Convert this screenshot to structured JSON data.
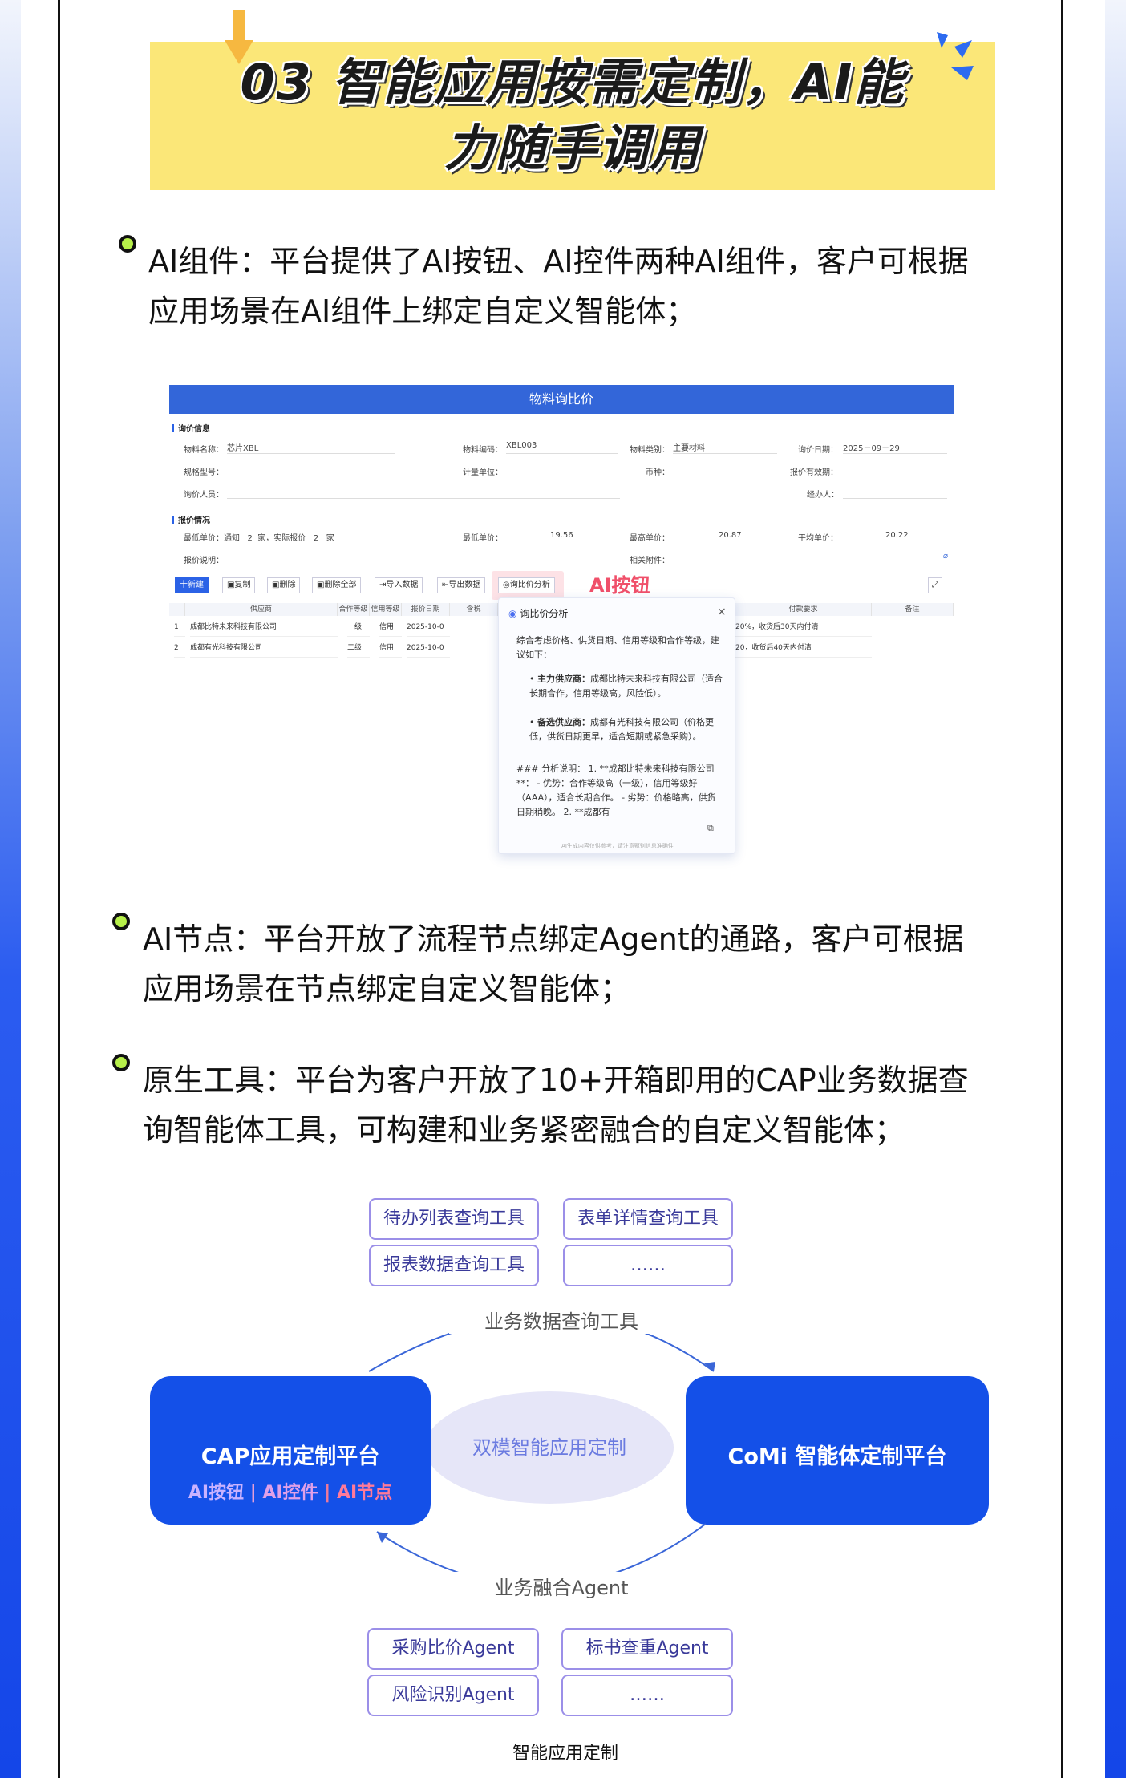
{
  "page": {
    "title_line1": "03 智能应用按需定制，AI能",
    "title_line2": "力随手调用",
    "bullets": [
      {
        "label": "AI组件：平台提供了AI按钮、AI控件两种AI组件，客户可根据",
        "label2": "应用场景在AI组件上绑定自定义智能体；"
      },
      {
        "label": "AI节点：平台开放了流程节点绑定Agent的通路，客户可根据",
        "label2": "应用场景在节点绑定自定义智能体；"
      },
      {
        "label": "原生工具：平台为客户开放了10+开箱即用的CAP业务数据查",
        "label2": "询智能体工具，可构建和业务紧密融合的自定义智能体；"
      }
    ],
    "colors": {
      "accent": "#1450e8",
      "highlight": "#fbe778",
      "bullet": "#b7f04a",
      "ai_red": "#f0506a"
    }
  },
  "shot": {
    "window_title": "物料询比价",
    "sec_inquiry": "询价信息",
    "fields": {
      "material_name_label": "物料名称：",
      "material_name": "芯片XBL",
      "material_code_label": "物料编码：",
      "material_code": "XBL003",
      "material_cat_label": "物料类别：",
      "material_cat": "主要材料",
      "inquiry_date_label": "询价日期：",
      "inquiry_date": "2025－09－29",
      "spec_label": "规格型号：",
      "unit_label": "计量单位：",
      "currency_label": "币种：",
      "valid_label": "报价有效期：",
      "inquirer_label": "询价人员：",
      "handler_label": "经办人："
    },
    "sec_quote": "报价情况",
    "quote": {
      "lowest_notice_label": "最低单价：通知",
      "notice_count": "2",
      "notice_mid": "家，实际报价",
      "actual_count": "2",
      "actual_unit": "家",
      "min_price_label": "最低单价：",
      "min_price": "19.56",
      "max_price_label": "最高单价：",
      "max_price": "20.87",
      "avg_price_label": "平均单价：",
      "avg_price": "20.22",
      "note_label": "报价说明：",
      "attach_label": "相关附件："
    },
    "toolbar": {
      "new": "十新建",
      "copy": "复制",
      "delete": "删除",
      "delete_all": "删除全部",
      "import": "导入数据",
      "export": "导出数据",
      "compare": "询比价分析",
      "ai_label": "AI按钮"
    },
    "table": {
      "headers": [
        "供应商",
        "合作等级",
        "信用等级",
        "报价日期",
        "含税",
        "付款要求",
        "备注"
      ],
      "rows": [
        {
          "no": "1",
          "supplier": "成都比特未来科技有限公司",
          "level": "一级",
          "credit": "信用",
          "date": "2025-10-0",
          "pay": "20%，收货后30天内付清"
        },
        {
          "no": "2",
          "supplier": "成都有光科技有限公司",
          "level": "二级",
          "credit": "信用",
          "date": "2025-10-0",
          "pay": "20，收货后40天内付清"
        }
      ]
    },
    "popup": {
      "title": "询比价分析",
      "intro": "综合考虑价格、供货日期、信用等级和合作等级，建议如下：",
      "main_label": "主力供应商：",
      "main_text": "成都比特未来科技有限公司（适合长期合作，信用等级高，风险低）。",
      "backup_label": "备选供应商：",
      "backup_text": "成都有光科技有限公司（价格更低，供货日期更早，适合短期或紧急采购）。",
      "analysis": "### 分析说明： 1. **成都比特未来科技有限公司**： - 优势：合作等级高（一级），信用等级好（AAA），适合长期合作。 - 劣势：价格略高，供货日期稍晚。 2. **成都有",
      "footer": "AI生成内容仅供参考，请注意甄别信息准确性"
    }
  },
  "diagram": {
    "top_tools": [
      "待办列表查询工具",
      "表单详情查询工具",
      "报表数据查询工具",
      "……"
    ],
    "top_arc": "业务数据查询工具",
    "left_box_title": "CAP应用定制平台",
    "left_box_sub": [
      "AI按钮",
      "AI控件",
      "AI节点"
    ],
    "center": "双模智能应用定制",
    "right_box_title": "CoMi 智能体定制平台",
    "bottom_arc": "业务融合Agent",
    "bottom_agents": [
      "采购比价Agent",
      "标书查重Agent",
      "风险识别Agent",
      "……"
    ],
    "caption": "智能应用定制"
  }
}
